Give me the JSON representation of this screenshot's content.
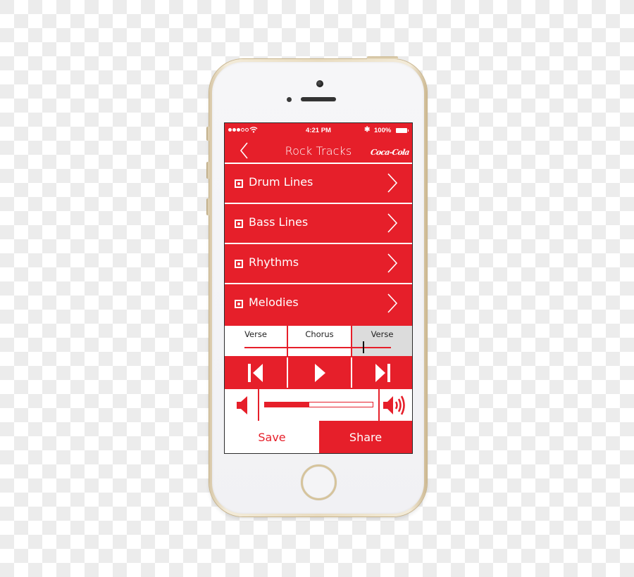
{
  "status_bar": {
    "signal_filled": 3,
    "signal_total": 5,
    "wifi": "wifi-icon",
    "time": "4:21 PM",
    "bluetooth": "bluetooth-icon",
    "battery_text": "100%",
    "battery_level": 1.0
  },
  "nav": {
    "back_icon": "chevron-left-icon",
    "title": "Rock Tracks",
    "brand": "Coca-Cola"
  },
  "tracks": [
    {
      "label": "Drum Lines",
      "icon": "track-square-icon",
      "chevron": "chevron-right-icon"
    },
    {
      "label": "Bass Lines",
      "icon": "track-square-icon",
      "chevron": "chevron-right-icon"
    },
    {
      "label": "Rhythms",
      "icon": "track-square-icon",
      "chevron": "chevron-right-icon"
    },
    {
      "label": "Melodies",
      "icon": "track-square-icon",
      "chevron": "chevron-right-icon"
    }
  ],
  "timeline": {
    "segments": [
      {
        "label": "Verse",
        "active": false
      },
      {
        "label": "Chorus",
        "active": false
      },
      {
        "label": "Verse",
        "active": true
      }
    ],
    "playhead_position": 0.81
  },
  "transport": {
    "prev_icon": "skip-back-icon",
    "play_icon": "play-icon",
    "next_icon": "skip-forward-icon"
  },
  "volume": {
    "low_icon": "volume-low-icon",
    "high_icon": "volume-high-icon",
    "level": 0.41
  },
  "actions": {
    "save_label": "Save",
    "share_label": "Share"
  },
  "colors": {
    "accent": "#e61f2a",
    "segment_active": "#dcdcdc",
    "playhead": "#111111"
  }
}
